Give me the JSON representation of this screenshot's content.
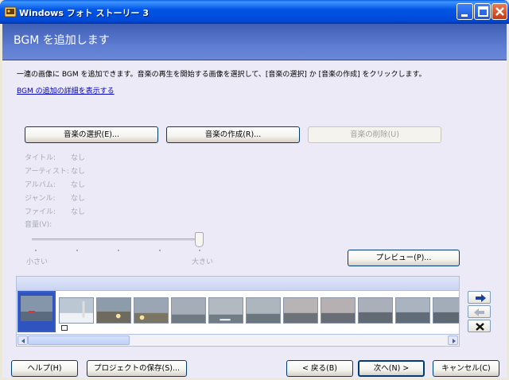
{
  "window": {
    "title": "Windows フォト ストーリー 3"
  },
  "header": {
    "heading": "BGM を追加します"
  },
  "main": {
    "description": "一連の画像に BGM を追加できます。音楽の再生を開始する画像を選択して、[音楽の選択] か [音楽の作成] をクリックします。",
    "details_link": "BGM の追加の詳細を表示する",
    "buttons": {
      "select_music": "音楽の選択(E)...",
      "create_music": "音楽の作成(R)...",
      "delete_music": "音楽の削除(U)",
      "preview": "プレビュー(P)..."
    },
    "properties": [
      {
        "label": "タイトル:",
        "value": "なし"
      },
      {
        "label": "アーティスト:",
        "value": "なし"
      },
      {
        "label": "アルバム:",
        "value": "なし"
      },
      {
        "label": "ジャンル:",
        "value": "なし"
      },
      {
        "label": "ファイル:",
        "value": "なし"
      }
    ],
    "volume": {
      "label": "音量(V):",
      "min_label": "小さい",
      "max_label": "大きい",
      "level": 1.0
    }
  },
  "filmstrip": {
    "thumbnail_count": 12,
    "selected_index": 0
  },
  "footer": {
    "help": "ヘルプ(H)",
    "save_project": "プロジェクトの保存(S)...",
    "back": "< 戻る(B)",
    "next": "次へ(N) >",
    "cancel": "キャンセル(C)"
  },
  "colors": {
    "titlebar": "#0055e5",
    "header": "#5d7cd1",
    "content": "#ebeaf6",
    "link": "#0000c0",
    "disabled_text": "#a8a8b8"
  }
}
